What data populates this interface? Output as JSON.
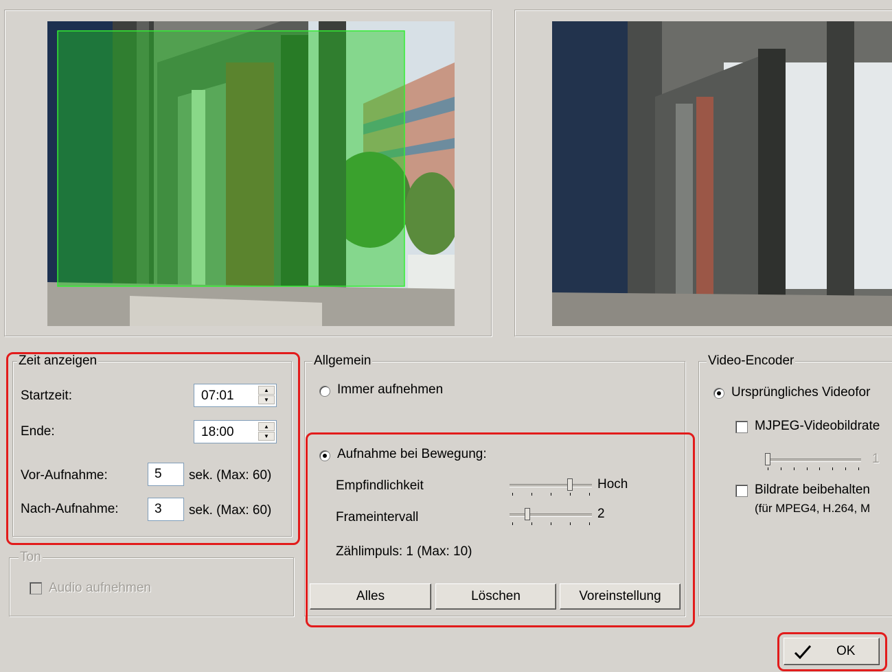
{
  "time_group": {
    "title": "Zeit anzeigen",
    "start_label": "Startzeit:",
    "start_value": "07:01",
    "end_label": "Ende:",
    "end_value": "18:00",
    "pre_label": "Vor-Aufnahme:",
    "pre_value": "5",
    "pre_unit": "sek.  (Max: 60)",
    "post_label": "Nach-Aufnahme:",
    "post_value": "3",
    "post_unit": "sek.  (Max: 60)"
  },
  "sound_group": {
    "title": "Ton",
    "audio_label": "Audio aufnehmen",
    "audio_checked": false
  },
  "general_group": {
    "title": "Allgemein",
    "always_label": "Immer aufnehmen",
    "motion_label": "Aufnahme bei Bewegung:",
    "selected": "motion",
    "sensitivity_label": "Empfindlichkeit",
    "sensitivity_value": "Hoch",
    "sensitivity_level": 0.75,
    "frame_label": "Frameintervall",
    "frame_value": "2",
    "frame_level": 0.2,
    "pulse_text": "Zählimpuls: 1 (Max: 10)",
    "btn_all": "Alles",
    "btn_delete": "Löschen",
    "btn_default": "Voreinstellung"
  },
  "encoder_group": {
    "title": "Video-Encoder",
    "original_label": "Ursprüngliches Videofor",
    "mjpeg_label": "MJPEG-Videobildrate",
    "mjpeg_value": "1",
    "mjpeg_level": 0.0,
    "keep_rate_label": "Bildrate beibehalten",
    "keep_rate_sub": "(für MPEG4, H.264, M"
  },
  "footer": {
    "ok_label": "OK",
    "ok_icon": "checkmark-icon"
  },
  "colors": {
    "annotation_red": "#e21b1b",
    "motion_area_green": "#22cc22",
    "dialog_bg": "#d6d3ce"
  }
}
